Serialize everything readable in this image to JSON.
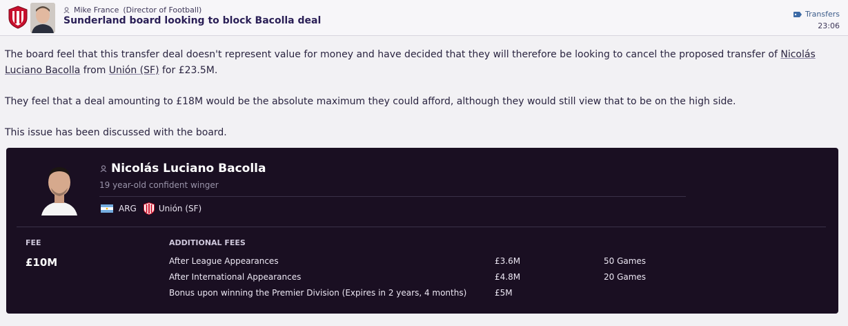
{
  "header": {
    "sender_name": "Mike France",
    "sender_role": "(Director of Football)",
    "subject": "Sunderland board looking to block Bacolla deal",
    "category": "Transfers",
    "time": "23:06"
  },
  "message": {
    "p1_before": "The board feel that this transfer deal doesn't represent value for money and have decided that they will therefore be looking to cancel the proposed transfer of ",
    "p1_player": "Nicolás Luciano Bacolla",
    "p1_from": " from ",
    "p1_club": "Unión (SF)",
    "p1_after": " for £23.5M.",
    "p2": "They feel that a deal amounting to £18M would be the absolute maximum they could afford, although they would still view that to be on the high side.",
    "p3": "This issue has been discussed with the board."
  },
  "player": {
    "name": "Nicolás Luciano Bacolla",
    "description": "19 year-old confident winger",
    "nation": "ARG",
    "club": "Unión (SF)"
  },
  "fees": {
    "fee_label": "FEE",
    "fee_value": "£10M",
    "additional_label": "ADDITIONAL FEES",
    "rows": [
      {
        "description": "After League Appearances",
        "amount": "£3.6M",
        "condition": "50 Games"
      },
      {
        "description": "After International Appearances",
        "amount": "£4.8M",
        "condition": "20 Games"
      },
      {
        "description": "Bonus upon winning the Premier Division (Expires in 2 years, 4 months)",
        "amount": "£5M",
        "condition": ""
      }
    ]
  },
  "colors": {
    "card_background": "#1a0f22",
    "page_background": "#f2f1f4",
    "subject_color": "#2a1f56",
    "category_color": "#3c5c8a"
  }
}
